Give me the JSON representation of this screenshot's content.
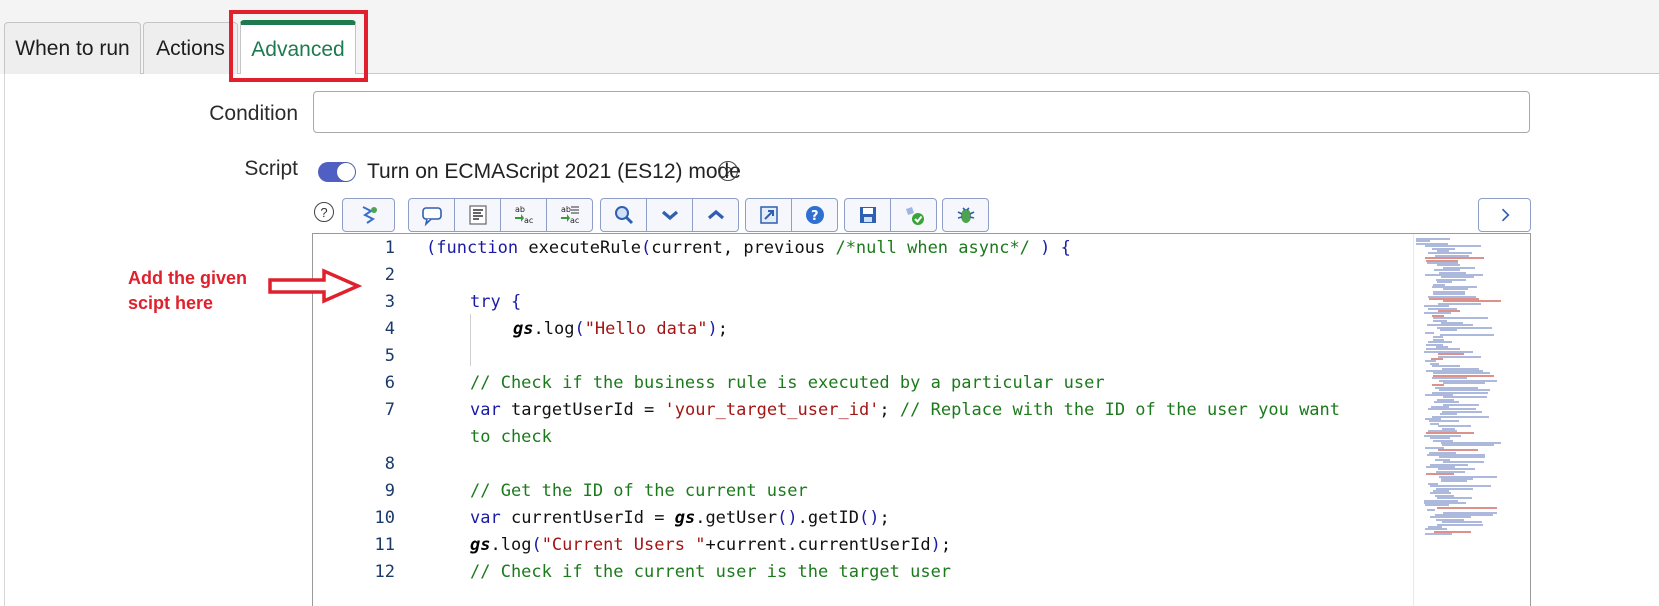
{
  "tabs": [
    {
      "label": "When to run",
      "active": false
    },
    {
      "label": "Actions",
      "active": false
    },
    {
      "label": "Advanced",
      "active": true
    }
  ],
  "form": {
    "condition_label": "Condition",
    "condition_value": "",
    "script_label": "Script",
    "es_mode_label": "Turn on ECMAScript 2021 (ES12) mode",
    "es_mode_enabled": true
  },
  "toolbar": {
    "icons": [
      "script-tree-icon",
      "comment-icon",
      "format-icon",
      "replace-icon",
      "replace-all-icon",
      "search-icon",
      "next-icon",
      "previous-icon",
      "fullscreen-icon",
      "help-icon",
      "save-icon",
      "syntax-check-icon",
      "debug-icon",
      "expand-icon"
    ]
  },
  "annotation": {
    "line1": "Add the given",
    "line2": "scipt here",
    "color": "#e0202c"
  },
  "code": {
    "line_numbers": [
      "1",
      "2",
      "3",
      "4",
      "5",
      "6",
      "7",
      "8",
      "9",
      "10",
      "11",
      "12"
    ],
    "lines": [
      "(function executeRule(current, previous /*null when async*/ ) {",
      "",
      "try {",
      "gs.log(\"Hello data\");",
      "",
      "// Check if the business rule is executed by a particular user",
      "var targetUserId = 'your_target_user_id'; // Replace with the ID of the user you want",
      "to check",
      "",
      "// Get the ID of the current user",
      "var currentUserId = gs.getUser().getID();",
      "gs.log(\"Current Users \"+current.currentUserId);",
      "// Check if the current user is the target user"
    ]
  },
  "colors": {
    "active_tab": "#1e7b4f",
    "toggle_on": "#4f5fc2",
    "keyword": "#1a1aa6",
    "comment": "#1b7a1b",
    "string": "#a31515"
  }
}
